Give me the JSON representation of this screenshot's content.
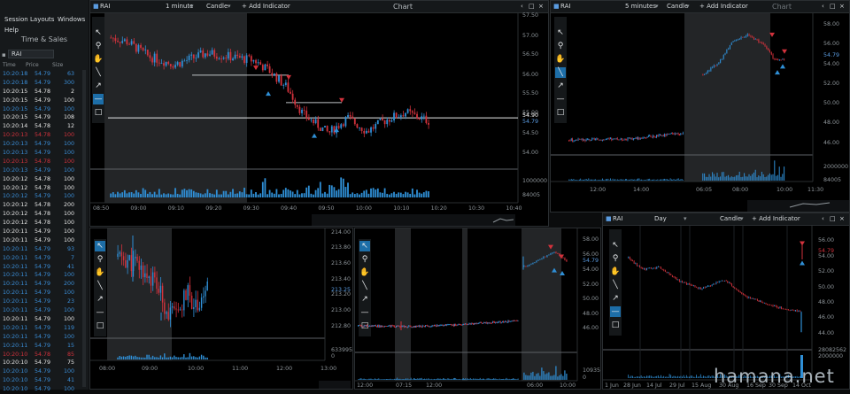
{
  "menu": {
    "session": "Session",
    "layouts": "Layouts",
    "windows": "Windows",
    "help": "Help"
  },
  "time_sales": {
    "title": "Time & Sales",
    "symbol": "RAI",
    "headers": {
      "time": "Time",
      "price": "Price",
      "size": "Size"
    },
    "rows": [
      {
        "time": "10:20:18",
        "price": "54.79",
        "size": "63",
        "color": "#3b8ed8"
      },
      {
        "time": "10:20:18",
        "price": "54.79",
        "size": "300",
        "color": "#3b8ed8"
      },
      {
        "time": "10:20:15",
        "price": "54.78",
        "size": "2",
        "color": "#e6e6e6"
      },
      {
        "time": "10:20:15",
        "price": "54.79",
        "size": "100",
        "color": "#e6e6e6"
      },
      {
        "time": "10:20:15",
        "price": "54.79",
        "size": "100",
        "color": "#3b8ed8"
      },
      {
        "time": "10:20:15",
        "price": "54.79",
        "size": "108",
        "color": "#e6e6e6"
      },
      {
        "time": "10:20:14",
        "price": "54.78",
        "size": "12",
        "color": "#e6e6e6"
      },
      {
        "time": "10:20:13",
        "price": "54.78",
        "size": "100",
        "color": "#d2323c"
      },
      {
        "time": "10:20:13",
        "price": "54.79",
        "size": "100",
        "color": "#3b8ed8"
      },
      {
        "time": "10:20:13",
        "price": "54.79",
        "size": "100",
        "color": "#3b8ed8"
      },
      {
        "time": "10:20:13",
        "price": "54.78",
        "size": "100",
        "color": "#d2323c"
      },
      {
        "time": "10:20:13",
        "price": "54.79",
        "size": "100",
        "color": "#3b8ed8"
      },
      {
        "time": "10:20:12",
        "price": "54.78",
        "size": "100",
        "color": "#e6e6e6"
      },
      {
        "time": "10:20:12",
        "price": "54.78",
        "size": "100",
        "color": "#e6e6e6"
      },
      {
        "time": "10:20:12",
        "price": "54.79",
        "size": "100",
        "color": "#3b8ed8"
      },
      {
        "time": "10:20:12",
        "price": "54.78",
        "size": "200",
        "color": "#e6e6e6"
      },
      {
        "time": "10:20:12",
        "price": "54.78",
        "size": "100",
        "color": "#e6e6e6"
      },
      {
        "time": "10:20:12",
        "price": "54.78",
        "size": "100",
        "color": "#e6e6e6"
      },
      {
        "time": "10:20:11",
        "price": "54.79",
        "size": "100",
        "color": "#e6e6e6"
      },
      {
        "time": "10:20:11",
        "price": "54.79",
        "size": "100",
        "color": "#e6e6e6"
      },
      {
        "time": "10:20:11",
        "price": "54.79",
        "size": "93",
        "color": "#3b8ed8"
      },
      {
        "time": "10:20:11",
        "price": "54.79",
        "size": "7",
        "color": "#3b8ed8"
      },
      {
        "time": "10:20:11",
        "price": "54.79",
        "size": "41",
        "color": "#3b8ed8"
      },
      {
        "time": "10:20:11",
        "price": "54.79",
        "size": "100",
        "color": "#3b8ed8"
      },
      {
        "time": "10:20:11",
        "price": "54.79",
        "size": "200",
        "color": "#3b8ed8"
      },
      {
        "time": "10:20:11",
        "price": "54.79",
        "size": "100",
        "color": "#3b8ed8"
      },
      {
        "time": "10:20:11",
        "price": "54.79",
        "size": "23",
        "color": "#3b8ed8"
      },
      {
        "time": "10:20:11",
        "price": "54.79",
        "size": "100",
        "color": "#3b8ed8"
      },
      {
        "time": "10:20:11",
        "price": "54.79",
        "size": "100",
        "color": "#e6e6e6"
      },
      {
        "time": "10:20:11",
        "price": "54.79",
        "size": "119",
        "color": "#3b8ed8"
      },
      {
        "time": "10:20:11",
        "price": "54.79",
        "size": "100",
        "color": "#3b8ed8"
      },
      {
        "time": "10:20:11",
        "price": "54.79",
        "size": "15",
        "color": "#3b8ed8"
      },
      {
        "time": "10:20:10",
        "price": "54.78",
        "size": "85",
        "color": "#d2323c"
      },
      {
        "time": "10:20:10",
        "price": "54.79",
        "size": "75",
        "color": "#e6e6e6"
      },
      {
        "time": "10:20:10",
        "price": "54.79",
        "size": "100",
        "color": "#3b8ed8"
      },
      {
        "time": "10:20:10",
        "price": "54.79",
        "size": "41",
        "color": "#3b8ed8"
      },
      {
        "time": "10:20:10",
        "price": "54.79",
        "size": "100",
        "color": "#3b8ed8"
      }
    ]
  },
  "chart_main": {
    "symbol": "RAI",
    "interval": "1 minute",
    "style": "Candle",
    "add_indicator": "+ Add Indicator",
    "title": "Chart",
    "y_ticks": [
      "57.50",
      "57.00",
      "56.50",
      "56.00",
      "55.50",
      "55.00",
      "54.90",
      "54.79",
      "54.50",
      "54.00"
    ],
    "vol_ticks": [
      "1000000",
      "84005"
    ],
    "x_ticks": [
      "08:50",
      "09:00",
      "09:10",
      "09:20",
      "09:30",
      "09:40",
      "09:50",
      "10:00",
      "10:10",
      "10:20",
      "10:30",
      "10:40"
    ]
  },
  "chart_tr": {
    "symbol": "RAI",
    "interval": "5 minutes",
    "style": "Candle",
    "add_indicator": "+ Add Indicator",
    "title": "Chart",
    "y_ticks": [
      "58.00",
      "56.00",
      "54.79",
      "54.00",
      "52.00",
      "50.00",
      "48.00",
      "46.00"
    ],
    "vol_ticks": [
      "2000000",
      "84005"
    ],
    "x_ticks": [
      "12:00",
      "14:00",
      "06:05",
      "08:00",
      "10:00",
      "11:30"
    ]
  },
  "chart_bl": {
    "y_ticks": [
      "214.00",
      "213.80",
      "213.60",
      "213.40",
      "213.25",
      "213.20",
      "213.00",
      "212.80"
    ],
    "vol_ticks": [
      "633995",
      "0"
    ],
    "x_ticks": [
      "08:00",
      "09:00",
      "10:00",
      "11:00",
      "12:00",
      "13:00"
    ]
  },
  "chart_bm": {
    "y_ticks": [
      "58.00",
      "56.00",
      "54.79",
      "54.00",
      "52.00",
      "50.00",
      "48.00",
      "46.00"
    ],
    "vol_ticks": [
      "1093509",
      "0"
    ],
    "x_ticks": [
      "12:00",
      "07:15",
      "12:00",
      "06:00",
      "10:00"
    ]
  },
  "chart_br": {
    "symbol": "RAI",
    "interval": "Day",
    "style": "Candle",
    "add_indicator": "+ Add Indicator",
    "y_ticks": [
      "56.00",
      "54.79",
      "54.00",
      "52.00",
      "50.00",
      "48.00",
      "46.00",
      "44.00"
    ],
    "vol_ticks": [
      "28082562",
      "2000000"
    ],
    "x_ticks": [
      "1 Jun",
      "28 Jun",
      "14 Jul",
      "29 Jul",
      "15 Aug",
      "30 Aug",
      "16 Sep",
      "30 Sep",
      "14 Oct"
    ]
  },
  "watermark": "hamana.net",
  "colors": {
    "up": "#2f8fd6",
    "down": "#d2323c",
    "selected_tool": "#1d6ea8",
    "shade": "#232527"
  }
}
